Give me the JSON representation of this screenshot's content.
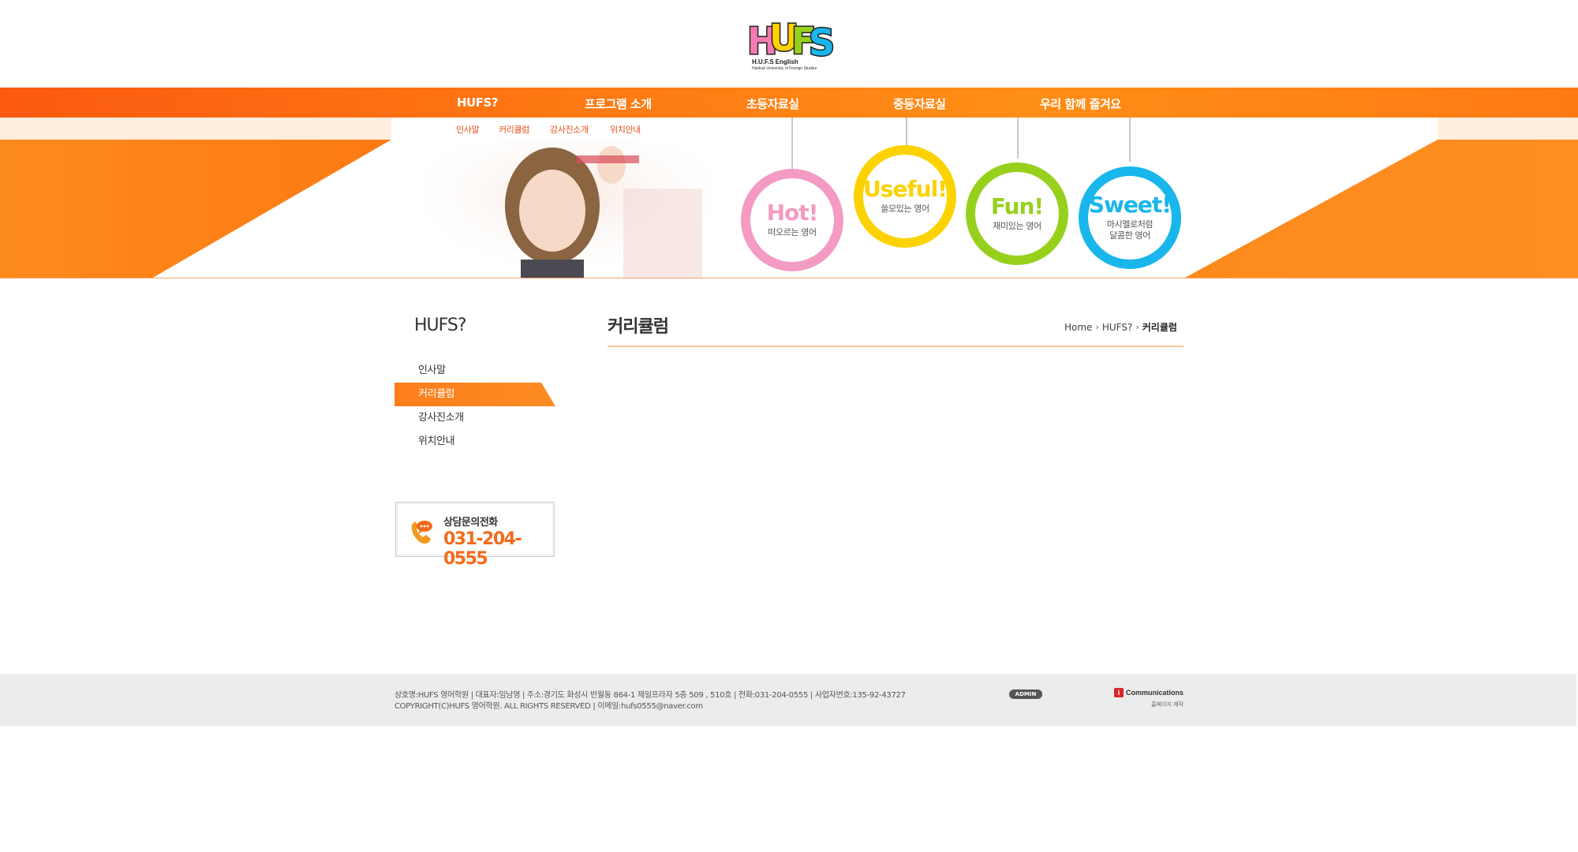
{
  "logo": {
    "letters": [
      "H",
      "U",
      "F",
      "S"
    ],
    "tagline": "H.U.F.S English",
    "subtitle": "Hankuk University of Foreign Studies"
  },
  "nav": {
    "items": [
      "HUFS?",
      "프로그램 소개",
      "초등자료실",
      "중등자료실",
      "우리 함께 즐겨요"
    ]
  },
  "subnav": {
    "items": [
      "인사말",
      "커리큘럼",
      "강사진소개",
      "위치안내"
    ]
  },
  "balloons": [
    {
      "word": "Hot!",
      "caption": "떠오르는 영어",
      "color": "#f39bc2"
    },
    {
      "word": "Useful!",
      "caption": "쓸모있는 영어",
      "color": "#fcd200"
    },
    {
      "word": "Fun!",
      "caption": "재미있는 영어",
      "color": "#97d01c"
    },
    {
      "word": "Sweet!",
      "caption": "마시멜로처럼\n달콤한 영어",
      "color": "#19b6ec"
    }
  ],
  "sidebar": {
    "title": "HUFS?",
    "items": [
      "인사말",
      "커리큘럼",
      "강사진소개",
      "위치안내"
    ],
    "active_index": 1,
    "contact": {
      "label": "상담문의전화",
      "number": "031-204-0555"
    }
  },
  "content": {
    "title": "커리큘럼",
    "breadcrumb": [
      "Home",
      "HUFS?",
      "커리큘럼"
    ]
  },
  "footer": {
    "line1": "상호명:HUFS 영어학원  |  대표자:임남영  |  주소:경기도 화성시 반월동 864-1 제일프라자 5층 509 , 510호  |  전화:031-204-0555  |  사업자번호:135-92-43727",
    "line2": "COPYRIGHT(C)HUFS 영어학원. ALL RIGHTS RESERVED  |  이메일:hufs0555@naver.com",
    "admin_label": "ADMIN",
    "maker_name": "Communications",
    "maker_sub": "홈페이지 제작"
  },
  "colors": {
    "primary_orange": "#fd7813",
    "accent_text_orange": "#e3521b",
    "footer_bg": "#ececec"
  }
}
